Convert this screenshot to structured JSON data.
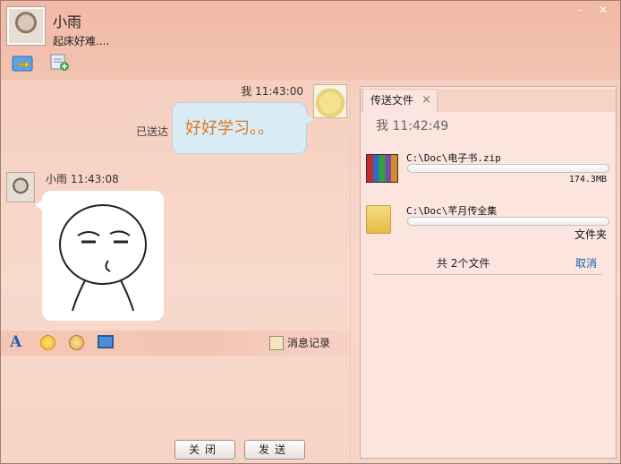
{
  "window": {
    "minimize": "–",
    "close": "✕"
  },
  "contact": {
    "name": "小雨",
    "status": "起床好难...."
  },
  "messages": [
    {
      "sender": "我",
      "time": "11:43:00",
      "text": "好好学习。。",
      "status": "已送达"
    },
    {
      "sender": "小雨",
      "time": "11:43:08",
      "content": "sticker"
    }
  ],
  "toolbar": {
    "history_label": "消息记录"
  },
  "buttons": {
    "close": "关闭",
    "send": "发送"
  },
  "transfer": {
    "tab_label": "传送文件",
    "tab_close": "×",
    "time": "我  11:42:49",
    "files": [
      {
        "path": "C:\\Doc\\电子书.zip",
        "size": "174.3MB",
        "progress": 0.0,
        "icon": "rar-archive-icon"
      },
      {
        "path": "C:\\Doc\\芊月传全集",
        "size": "文件夹",
        "progress": 0.0,
        "icon": "folder-icon"
      }
    ],
    "summary": "共 2个文件",
    "cancel": "取消"
  },
  "colors": {
    "accent_orange": "#e0751e",
    "link_blue": "#1a5fb4",
    "bubble_blue": "#d9ecf5"
  }
}
